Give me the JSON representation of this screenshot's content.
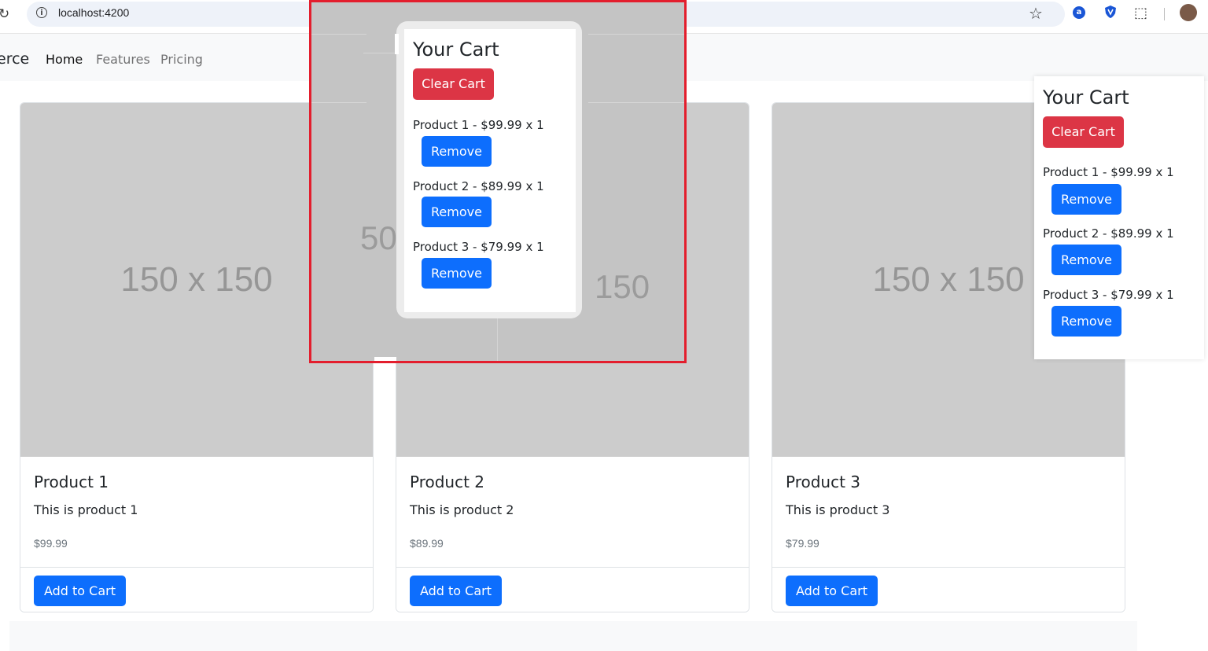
{
  "browser": {
    "url": "localhost:4200"
  },
  "navbar": {
    "brand": "erce",
    "links": [
      {
        "label": "Home",
        "active": true
      },
      {
        "label": "Features",
        "active": false
      },
      {
        "label": "Pricing",
        "active": false
      }
    ]
  },
  "products": [
    {
      "title": "Product 1",
      "description": "This is product 1",
      "price": "$99.99",
      "image_placeholder": "150 x 150",
      "button": "Add to Cart"
    },
    {
      "title": "Product 2",
      "description": "This is product 2",
      "price": "$89.99",
      "image_placeholder": "150 x 150",
      "button": "Add to Cart"
    },
    {
      "title": "Product 3",
      "description": "This is product 3",
      "price": "$79.99",
      "image_placeholder": "150 x 150",
      "button": "Add to Cart"
    }
  ],
  "cart": {
    "title": "Your Cart",
    "clear_label": "Clear Cart",
    "items": [
      {
        "text": "Product 1 - $99.99 x 1",
        "remove_label": "Remove"
      },
      {
        "text": "Product 2 - $89.99 x 1",
        "remove_label": "Remove"
      },
      {
        "text": "Product 3 - $79.99 x 1",
        "remove_label": "Remove"
      }
    ]
  },
  "zoom": {
    "fragment_left": "50",
    "fragment_right": "150"
  },
  "colors": {
    "primary": "#0d6efd",
    "danger": "#dc3545",
    "highlight_border": "#e31e2d",
    "placeholder_bg": "#cccccc"
  }
}
